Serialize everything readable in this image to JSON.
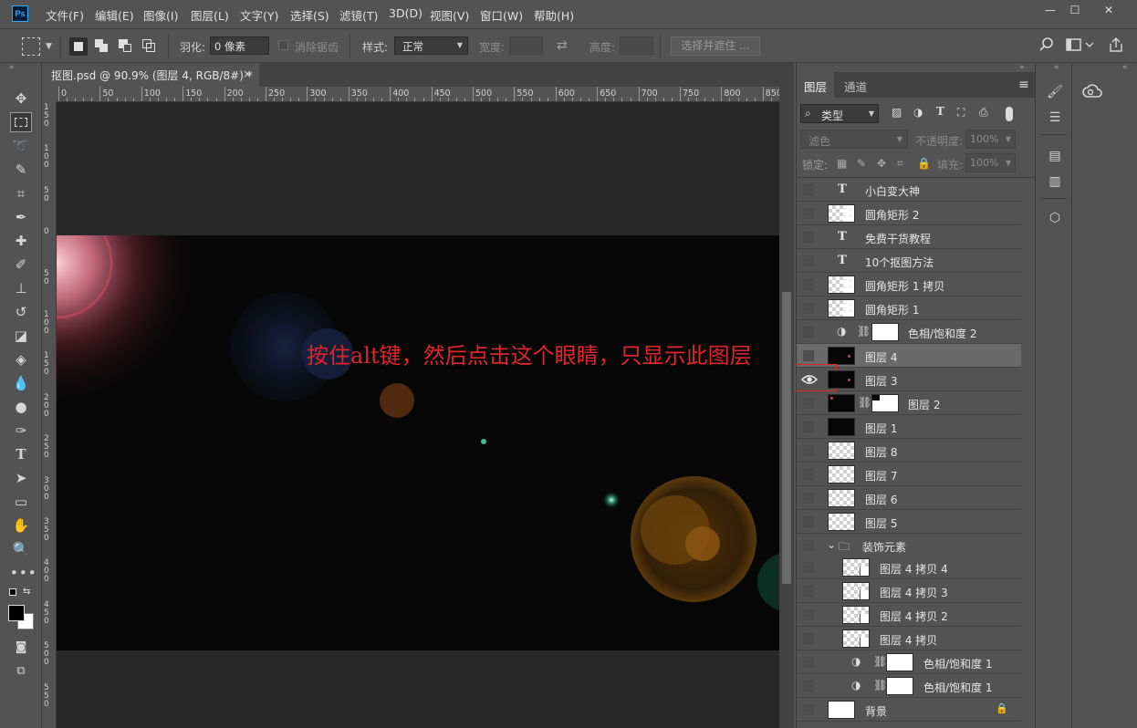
{
  "app": {
    "logo": "Ps",
    "menus": [
      "文件(F)",
      "编辑(E)",
      "图像(I)",
      "图层(L)",
      "文字(Y)",
      "选择(S)",
      "滤镜(T)",
      "3D(D)",
      "视图(V)",
      "窗口(W)",
      "帮助(H)"
    ],
    "window_controls": [
      "—",
      "☐",
      "✕"
    ]
  },
  "options": {
    "feather_label": "羽化:",
    "feather_value": "0 像素",
    "antialias_label": "消除锯齿",
    "style_label": "样式:",
    "style_value": "正常",
    "width_label": "宽度:",
    "height_label": "高度:",
    "select_mask_button": "选择并遮住 ..."
  },
  "document": {
    "tab_title": "抠图.psd @ 90.9% (图层 4, RGB/8#) *",
    "tab_close": "×",
    "annotation": "按住alt键，然后点击这个眼睛，只显示此图层"
  },
  "ruler": {
    "h_labels": [
      "0",
      "50",
      "100",
      "150",
      "200",
      "250",
      "300",
      "350",
      "400",
      "450",
      "500",
      "550",
      "600",
      "650",
      "700",
      "750",
      "800",
      "850"
    ],
    "v_labels": [
      "150",
      "100",
      "50",
      "0",
      "50",
      "100",
      "150",
      "200",
      "250",
      "300",
      "350",
      "400",
      "450",
      "500",
      "550"
    ]
  },
  "layers_panel": {
    "tabs": [
      "图层",
      "通道"
    ],
    "filter_kind": "类型",
    "blend_mode": "滤色",
    "opacity_label": "不透明度:",
    "opacity_value": "100%",
    "lock_label": "锁定:",
    "fill_label": "填充:",
    "fill_value": "100%",
    "layers": [
      {
        "name": "小白变大神",
        "kind": "text",
        "visible": false
      },
      {
        "name": "圆角矩形 2",
        "kind": "shape",
        "visible": false
      },
      {
        "name": "免费干货教程",
        "kind": "text",
        "visible": false
      },
      {
        "name": "10个抠图方法",
        "kind": "text",
        "visible": false
      },
      {
        "name": "圆角矩形 1 拷贝",
        "kind": "shape",
        "visible": false
      },
      {
        "name": "圆角矩形 1",
        "kind": "shape",
        "visible": false
      },
      {
        "name": "色相/饱和度 2",
        "kind": "adjust",
        "visible": false
      },
      {
        "name": "图层 4",
        "kind": "pixel",
        "visible": false,
        "selected": true
      },
      {
        "name": "图层 3",
        "kind": "pixel",
        "visible": true
      },
      {
        "name": "图层 2",
        "kind": "masked",
        "visible": false
      },
      {
        "name": "图层 1",
        "kind": "pixel-black",
        "visible": false
      },
      {
        "name": "图层 8",
        "kind": "checker",
        "visible": false
      },
      {
        "name": "图层 7",
        "kind": "checker",
        "visible": false
      },
      {
        "name": "图层 6",
        "kind": "checker",
        "visible": false
      },
      {
        "name": "图层 5",
        "kind": "checker",
        "visible": false
      },
      {
        "name": "装饰元素",
        "kind": "group",
        "visible": false
      },
      {
        "name": "图层 4 拷贝 4",
        "kind": "smart",
        "visible": false
      },
      {
        "name": "图层 4 拷贝 3",
        "kind": "smart",
        "visible": false
      },
      {
        "name": "图层 4 拷贝 2",
        "kind": "smart",
        "visible": false
      },
      {
        "name": "图层 4 拷贝",
        "kind": "smart",
        "visible": false
      },
      {
        "name": "色相/饱和度 1",
        "kind": "adjust-nested",
        "visible": false
      },
      {
        "name": "色相/饱和度 1",
        "kind": "adjust-nested",
        "visible": false
      },
      {
        "name": "背景",
        "kind": "background",
        "visible": false
      }
    ]
  },
  "colors": {
    "accent_red": "#e0242a",
    "panel_bg": "#535353",
    "dark_bg": "#424242"
  }
}
